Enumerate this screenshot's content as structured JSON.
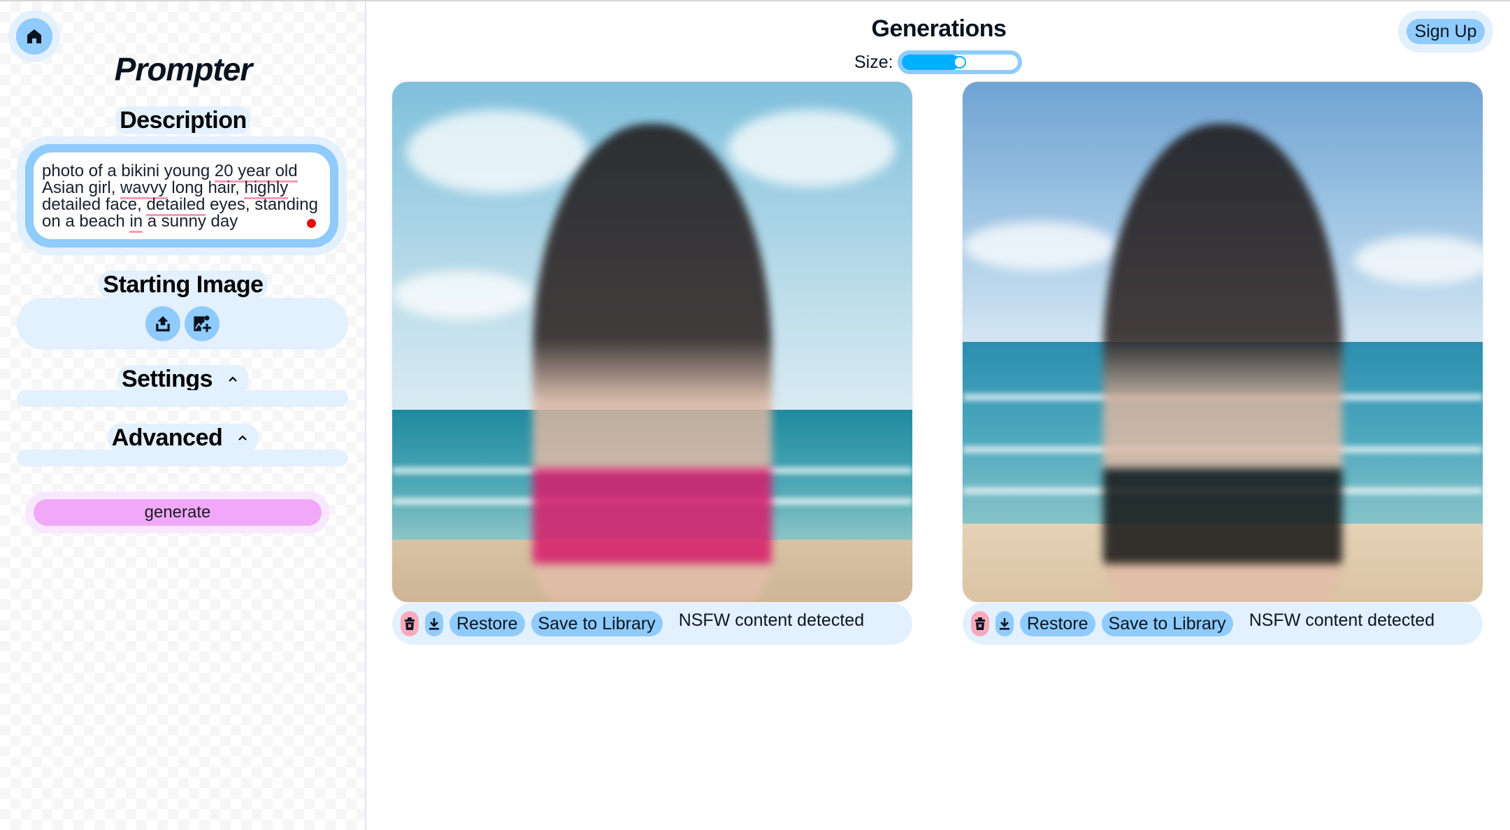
{
  "sidebar": {
    "home_icon": "home-icon",
    "brand": "Prompter",
    "description": {
      "title": "Description",
      "value_segments": [
        {
          "text": "photo of a bikini young ",
          "misspelled": false
        },
        {
          "text": "20 year old",
          "misspelled": true
        },
        {
          "text": " Asian girl, ",
          "misspelled": false
        },
        {
          "text": "wavvy",
          "misspelled": true
        },
        {
          "text": " long hair, ",
          "misspelled": false
        },
        {
          "text": "highly",
          "misspelled": true
        },
        {
          "text": " detailed face, ",
          "misspelled": false
        },
        {
          "text": "detailed",
          "misspelled": true
        },
        {
          "text": " eyes, standing on a beach ",
          "misspelled": false
        },
        {
          "text": "in",
          "misspelled": true
        },
        {
          "text": " a sunny day",
          "misspelled": false
        }
      ]
    },
    "starting_image": {
      "title": "Starting Image",
      "upload_icon": "upload-icon",
      "add_image_icon": "add-image-icon"
    },
    "settings": {
      "title": "Settings",
      "expanded": false,
      "toggle_icon": "chevron-up-icon"
    },
    "advanced": {
      "title": "Advanced",
      "expanded": false,
      "toggle_icon": "chevron-up-icon"
    },
    "generate_label": "generate"
  },
  "header": {
    "title": "Generations",
    "size_label": "Size:",
    "size_value": 0.5,
    "signup_label": "Sign Up"
  },
  "generations": [
    {
      "image_alt": "Generated image 1",
      "swimwear_color": "#d81b6a",
      "actions": {
        "delete_icon": "trash-icon",
        "download_icon": "download-icon",
        "restore": "Restore",
        "save": "Save to Library"
      },
      "status": "NSFW content detected"
    },
    {
      "image_alt": "Generated image 2",
      "swimwear_color": "#151515",
      "actions": {
        "delete_icon": "trash-icon",
        "download_icon": "download-icon",
        "restore": "Restore",
        "save": "Save to Library"
      },
      "status": "NSFW content detected"
    }
  ],
  "colors": {
    "accent_light": "#e3f0fe",
    "accent": "#8fcbfc",
    "slider_fill": "#00b0ff",
    "generate": "#f2a8f8",
    "delete": "#f8aabb"
  }
}
